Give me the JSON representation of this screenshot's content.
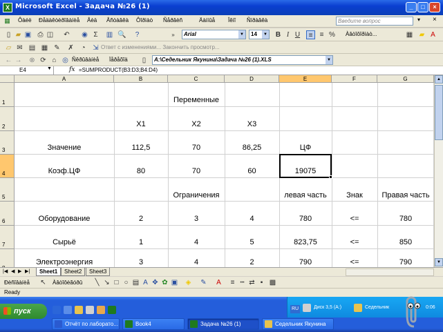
{
  "window": {
    "title": "Microsoft Excel - Задача №26 (1)"
  },
  "menu": {
    "items": [
      "Ôàéë",
      "Ðåäàêòèðîâàíèå",
      "Âèä",
      "Âñòàâêà",
      "Ôîðìàò",
      "Ñåðâèñ",
      "Äàííûå",
      "Îêíî",
      "Ñïðàâêà"
    ],
    "help_placeholder": "Введите вопрос"
  },
  "toolbar": {
    "font_name": "Arial",
    "font_size": "14",
    "autoformat_label": "Àâòîôîðìàò...",
    "reply_label": "Ответ с изменениями... Закончить просмотр...",
    "security_label": "Ñêðûâàíèå",
    "navigate_label": "Ïåðåõîä",
    "address": "A:\\Седельник Якунина\\Задача №26 (1).XLS"
  },
  "formula_bar": {
    "name_box": "E4",
    "fx": "fx",
    "formula": "=SUMPRODUCT(B3:D3;B4:D4)"
  },
  "columns": [
    "A",
    "B",
    "C",
    "D",
    "E",
    "F",
    "G"
  ],
  "rows": [
    "1",
    "2",
    "3",
    "4",
    "5",
    "6",
    "7",
    "8"
  ],
  "cells": {
    "r1_c": "Переменные",
    "r2_b": "X1",
    "r2_c": "X2",
    "r2_d": "X3",
    "r3_a": "Значение",
    "r3_b": "112,5",
    "r3_c": "70",
    "r3_d": "86,25",
    "r3_e": "ЦФ",
    "r4_a": "Коэф.ЦФ",
    "r4_b": "80",
    "r4_c": "70",
    "r4_d": "60",
    "r4_e": "19075",
    "r5_c": "Ограничения",
    "r5_e": "левая часть",
    "r5_f": "Знак",
    "r5_g": "Правая часть",
    "r6_a": "Оборудование",
    "r6_b": "2",
    "r6_c": "3",
    "r6_d": "4",
    "r6_e": "780",
    "r6_f": "<=",
    "r6_g": "780",
    "r7_a": "Сырьё",
    "r7_b": "1",
    "r7_c": "4",
    "r7_d": "5",
    "r7_e": "823,75",
    "r7_f": "<=",
    "r7_g": "850",
    "r8_a": "Электроэнергия",
    "r8_b": "3",
    "r8_c": "4",
    "r8_d": "2",
    "r8_e": "790",
    "r8_f": "<=",
    "r8_g": "790"
  },
  "sheet_tabs": [
    "Sheet1",
    "Sheet2",
    "Sheet3"
  ],
  "drawing": {
    "draw_label": "Ðèñîâàíèå",
    "autoshapes_label": "Àâòîôèãóðû"
  },
  "status": {
    "text": "Ready"
  },
  "taskbar": {
    "start_label": "пуск",
    "lang": "RU",
    "tray_text": "Диск 3,5 (A:)",
    "tray_folder": "Седельник",
    "clock": "0:06",
    "tasks": [
      "Отчёт по лаборато...",
      "Book4",
      "Задача №26 (1)",
      "Седельник Якунина"
    ]
  },
  "colors": {
    "title_bar": "#0a3fd0",
    "taskbar": "#245edb",
    "start": "#2f8a2f"
  }
}
